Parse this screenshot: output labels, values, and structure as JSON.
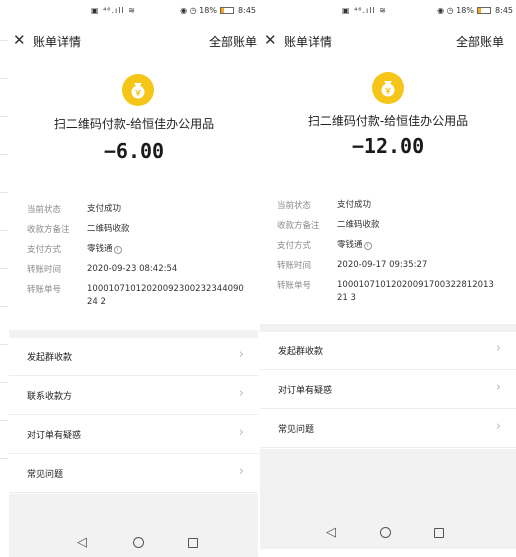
{
  "screens": [
    {
      "status": {
        "center": "▣ ⁴⁶.ıll ≋",
        "right": "◉ ◷ 18%",
        "time": "8:45"
      },
      "nav": {
        "close": "✕",
        "title": "账单详情",
        "all_bills": "全部账单"
      },
      "merchant": "扫二维码付款-给恒佳办公用品",
      "amount": "−6.00",
      "details": [
        {
          "label": "当前状态",
          "value": "支付成功"
        },
        {
          "label": "收款方备注",
          "value": "二维码收款"
        },
        {
          "label": "支付方式",
          "value": "零钱通"
        },
        {
          "label": "转账时间",
          "value": "2020-09-23 08:42:54"
        },
        {
          "label": "转账单号",
          "value": "1000107101202009230023234409024 2"
        }
      ],
      "actions": [
        "发起群收款",
        "联系收款方",
        "对订单有疑惑",
        "常见问题"
      ],
      "sysnav": [
        "◁",
        "○",
        "□"
      ]
    },
    {
      "status": {
        "center": "▣ ⁴⁶.ıll ≋",
        "right": "◉ ◷ 18%",
        "time": "8:45"
      },
      "nav": {
        "close": "✕",
        "title": "账单详情",
        "all_bills": "全部账单"
      },
      "merchant": "扫二维码付款-给恒佳办公用品",
      "amount": "−12.00",
      "details": [
        {
          "label": "当前状态",
          "value": "支付成功"
        },
        {
          "label": "收款方备注",
          "value": "二维码收款"
        },
        {
          "label": "支付方式",
          "value": "零钱通"
        },
        {
          "label": "转账时间",
          "value": "2020-09-17 09:35:27"
        },
        {
          "label": "转账单号",
          "value": "1000107101202009170032281201321 3"
        }
      ],
      "actions": [
        "发起群收款",
        "对订单有疑惑",
        "常见问题"
      ],
      "sysnav": [
        "◁",
        "○",
        "□"
      ]
    }
  ],
  "colors": {
    "coin": "#f5c518",
    "separator": "#f2f2f2",
    "label": "#8a8a8a"
  },
  "icons": {
    "coin": "money-bag-icon",
    "chevron": "chevron-right-icon",
    "info": "info-icon"
  }
}
